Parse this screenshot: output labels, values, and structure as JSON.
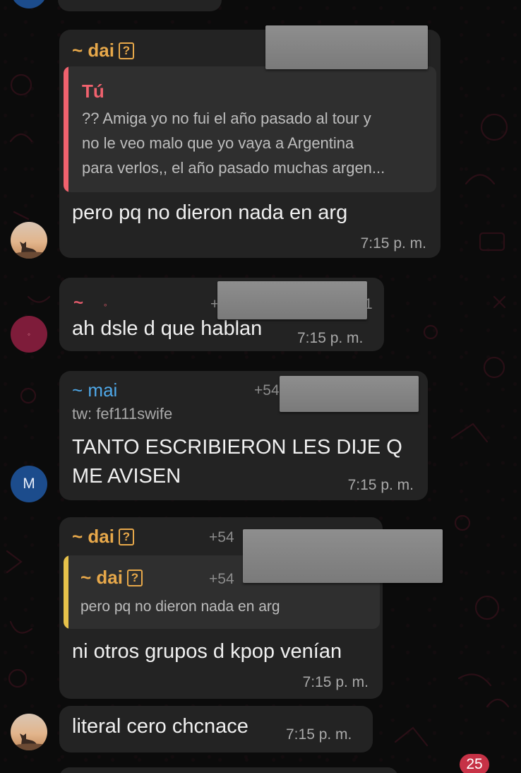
{
  "colors": {
    "dai": "#e7a84a",
    "tu": "#f0626e",
    "mai": "#4fa8e8",
    "third": "#e05a6a",
    "quote_bar_pink": "#f0626e",
    "quote_bar_yellow": "#e7c24a",
    "unread_badge": "#c63246"
  },
  "messages": [
    {
      "sender": "~ dai",
      "quote": {
        "author": "Tú",
        "lines": [
          "?? Amiga yo no fui el año pasado al tour y",
          "no le veo malo que yo vaya a Argentina",
          "para verlos,, el año pasado muchas argen..."
        ]
      },
      "text": "pero pq no dieron nada en arg",
      "time": "7:15 p. m."
    },
    {
      "sender": "~",
      "sender_dot": "◦",
      "phone_prefix": "+",
      "phone_suffix": "1",
      "text": "ah dsle d que hablan",
      "time": "7:15 p. m."
    },
    {
      "sender": "~ mai",
      "phone_prefix": "+54",
      "subtitle": "tw: fef111swife",
      "text_lines": [
        "TANTO ESCRIBIERON LES DIJE Q",
        "ME AVISEN"
      ],
      "time": "7:15 p. m.",
      "avatar_letter": "M"
    },
    {
      "sender": "~ dai",
      "phone_prefix": "+54",
      "quote": {
        "author": "~ dai",
        "phone_prefix": "+54",
        "line": "pero pq no dieron nada en arg"
      },
      "text": "ni otros grupos d kpop venían",
      "time": "7:15 p. m."
    },
    {
      "text": "literal cero chcnace",
      "time": "7:15 p. m."
    }
  ],
  "unread_count": "25",
  "icons": {
    "verify": "question-box-icon",
    "avatar_photo": "sunset-cat-avatar"
  }
}
